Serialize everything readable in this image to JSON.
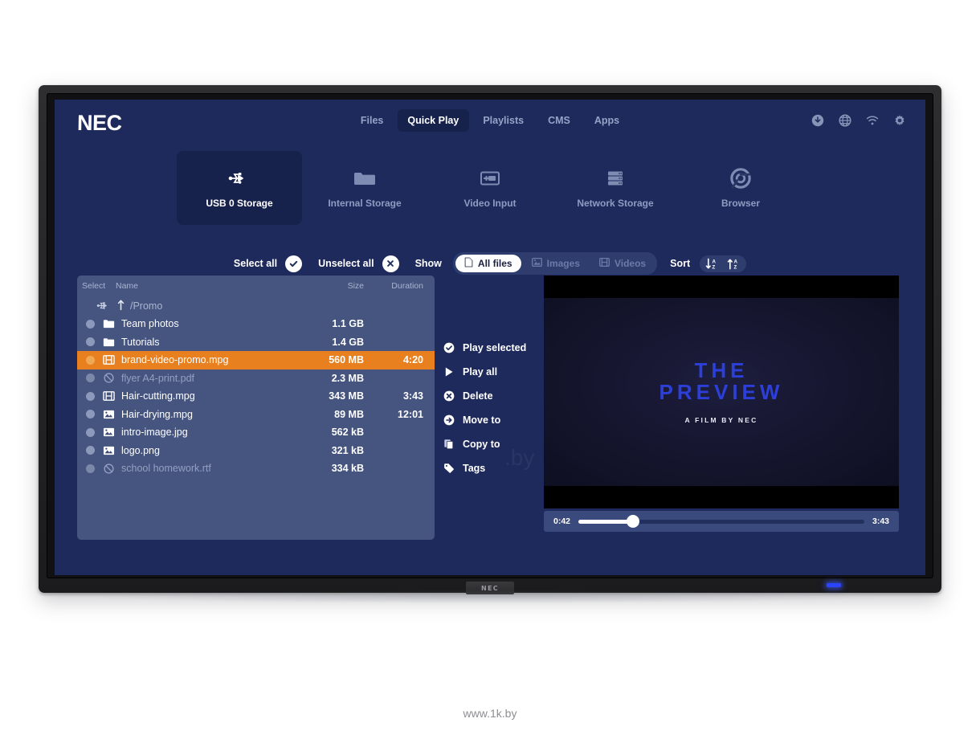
{
  "brand": {
    "logo": "NEC",
    "bezel_badge": "NEC"
  },
  "header": {
    "nav": [
      {
        "label": "Files",
        "active": false
      },
      {
        "label": "Quick Play",
        "active": true
      },
      {
        "label": "Playlists",
        "active": false
      },
      {
        "label": "CMS",
        "active": false
      },
      {
        "label": "Apps",
        "active": false
      }
    ],
    "icons": [
      "download-icon",
      "globe-icon",
      "wifi-icon",
      "gear-icon"
    ]
  },
  "sources": [
    {
      "label": "USB 0 Storage",
      "icon": "usb-icon",
      "active": true
    },
    {
      "label": "Internal Storage",
      "icon": "folder-icon",
      "active": false
    },
    {
      "label": "Video Input",
      "icon": "video-input-icon",
      "active": false
    },
    {
      "label": "Network Storage",
      "icon": "server-icon",
      "active": false
    },
    {
      "label": "Browser",
      "icon": "browser-icon",
      "active": false
    }
  ],
  "toolbar": {
    "select_all": "Select all",
    "unselect_all": "Unselect all",
    "show": "Show",
    "filters": [
      {
        "label": "All files",
        "icon": "file-icon",
        "active": true
      },
      {
        "label": "Images",
        "icon": "image-icon",
        "active": false
      },
      {
        "label": "Videos",
        "icon": "film-icon",
        "active": false
      }
    ],
    "sort": "Sort",
    "sort_buttons": [
      "sort-descending-az-icon",
      "sort-ascending-az-icon"
    ]
  },
  "file_list": {
    "columns": {
      "select": "Select",
      "name": "Name",
      "size": "Size",
      "duration": "Duration"
    },
    "breadcrumb": {
      "path": "/Promo",
      "device_icon": "usb-icon",
      "up_icon": "arrow-up-icon"
    },
    "rows": [
      {
        "name": "Team photos",
        "size": "1.1 GB",
        "duration": "",
        "icon": "folder-icon",
        "state": "normal"
      },
      {
        "name": "Tutorials",
        "size": "1.4 GB",
        "duration": "",
        "icon": "folder-icon",
        "state": "normal"
      },
      {
        "name": "brand-video-promo.mpg",
        "size": "560 MB",
        "duration": "4:20",
        "icon": "film-icon",
        "state": "selected"
      },
      {
        "name": "flyer A4-print.pdf",
        "size": "2.3 MB",
        "duration": "",
        "icon": "blocked-icon",
        "state": "disabled"
      },
      {
        "name": "Hair-cutting.mpg",
        "size": "343 MB",
        "duration": "3:43",
        "icon": "film-icon",
        "state": "normal"
      },
      {
        "name": "Hair-drying.mpg",
        "size": "89 MB",
        "duration": "12:01",
        "icon": "image-icon",
        "state": "normal"
      },
      {
        "name": "intro-image.jpg",
        "size": "562 kB",
        "duration": "",
        "icon": "image-icon",
        "state": "normal"
      },
      {
        "name": "logo.png",
        "size": "321 kB",
        "duration": "",
        "icon": "image-icon",
        "state": "normal"
      },
      {
        "name": "school homework.rtf",
        "size": "334 kB",
        "duration": "",
        "icon": "blocked-icon",
        "state": "disabled"
      }
    ]
  },
  "actions": [
    {
      "label": "Play selected",
      "icon": "check-circle-icon"
    },
    {
      "label": "Play all",
      "icon": "play-icon"
    },
    {
      "label": "Delete",
      "icon": "x-circle-icon"
    },
    {
      "label": "Move to",
      "icon": "arrow-right-circle-icon"
    },
    {
      "label": "Copy to",
      "icon": "copy-icon"
    },
    {
      "label": "Tags",
      "icon": "tag-icon"
    }
  ],
  "preview": {
    "title_line1": "THE",
    "title_line2": "PREVIEW",
    "subtitle": "A FILM BY NEC",
    "current_time": "0:42",
    "total_time": "3:43",
    "progress_percent": 19
  },
  "watermark": {
    "site": "www.1k.by",
    "overlay": ".by"
  },
  "colors": {
    "screen_bg": "#1e2a5c",
    "panel_bg": "#465580",
    "accent_selected": "#e8801f",
    "nav_active_bg": "#16224c",
    "film_title": "#2c3fd8"
  }
}
